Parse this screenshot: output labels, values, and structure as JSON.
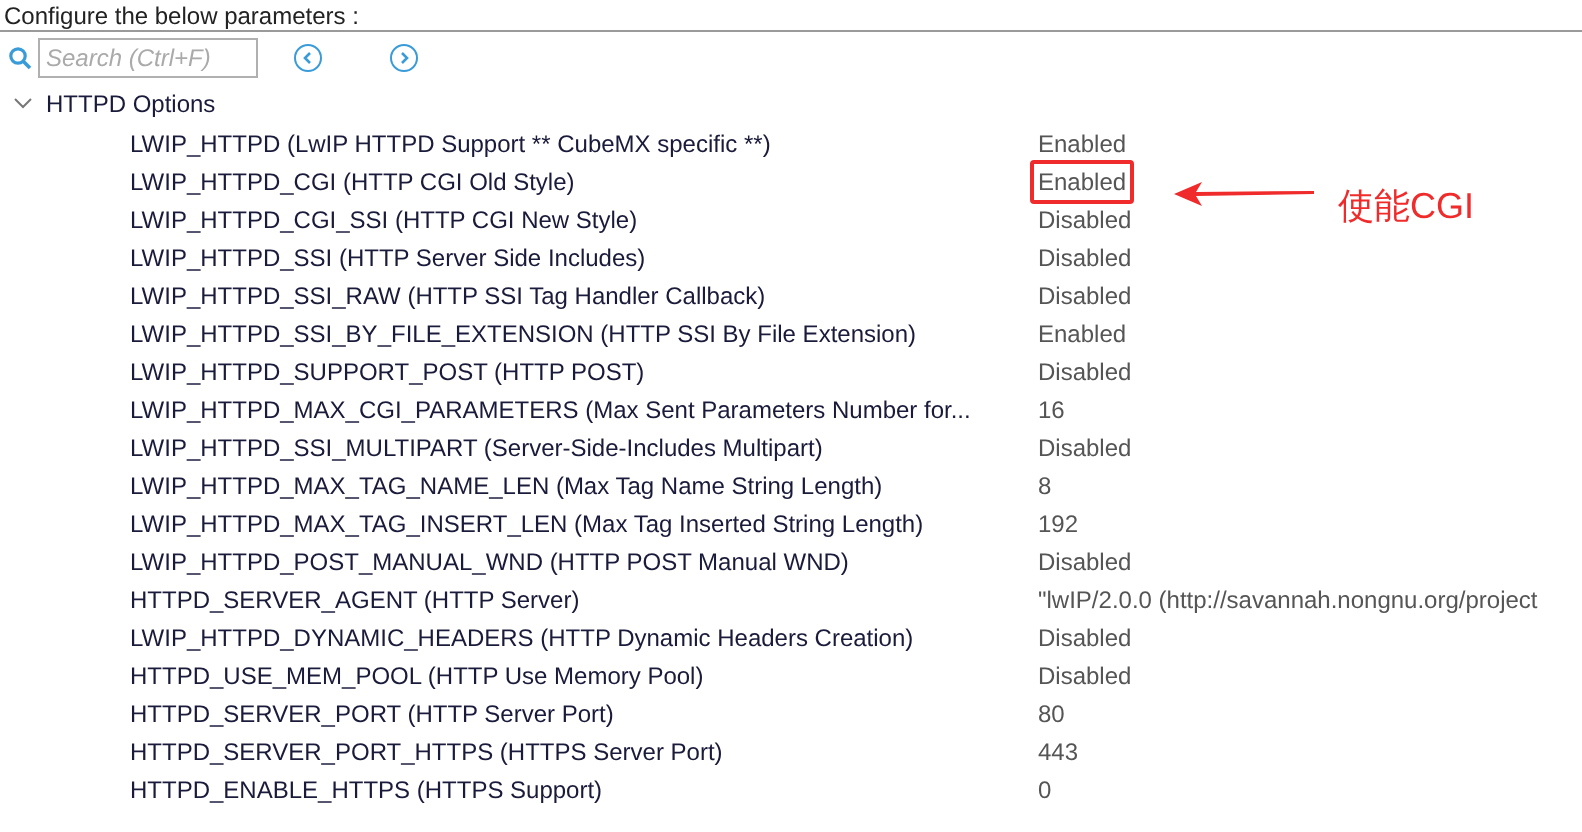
{
  "header": {
    "text": "Configure the below parameters :"
  },
  "search": {
    "placeholder": "Search (Ctrl+F)"
  },
  "tree": {
    "label": "HTTPD Options",
    "expanded": true,
    "children": [
      {
        "name": "LWIP_HTTPD (LwIP HTTPD Support ** CubeMX specific **)",
        "value": "Enabled",
        "highlighted": false
      },
      {
        "name": "LWIP_HTTPD_CGI (HTTP CGI Old Style)",
        "value": "Enabled",
        "highlighted": true
      },
      {
        "name": "LWIP_HTTPD_CGI_SSI (HTTP CGI New Style)",
        "value": "Disabled",
        "highlighted": false
      },
      {
        "name": "LWIP_HTTPD_SSI (HTTP Server Side Includes)",
        "value": "Disabled",
        "highlighted": false
      },
      {
        "name": "LWIP_HTTPD_SSI_RAW (HTTP SSI Tag Handler Callback)",
        "value": "Disabled",
        "highlighted": false
      },
      {
        "name": "LWIP_HTTPD_SSI_BY_FILE_EXTENSION (HTTP SSI By File Extension)",
        "value": "Enabled",
        "highlighted": false
      },
      {
        "name": "LWIP_HTTPD_SUPPORT_POST (HTTP POST)",
        "value": "Disabled",
        "highlighted": false
      },
      {
        "name": "LWIP_HTTPD_MAX_CGI_PARAMETERS (Max Sent Parameters Number for...",
        "value": "16",
        "highlighted": false
      },
      {
        "name": "LWIP_HTTPD_SSI_MULTIPART (Server-Side-Includes Multipart)",
        "value": "Disabled",
        "highlighted": false
      },
      {
        "name": "LWIP_HTTPD_MAX_TAG_NAME_LEN (Max Tag Name String Length)",
        "value": "8",
        "highlighted": false
      },
      {
        "name": "LWIP_HTTPD_MAX_TAG_INSERT_LEN (Max Tag Inserted String Length)",
        "value": "192",
        "highlighted": false
      },
      {
        "name": "LWIP_HTTPD_POST_MANUAL_WND (HTTP POST Manual WND)",
        "value": "Disabled",
        "highlighted": false
      },
      {
        "name": "HTTPD_SERVER_AGENT (HTTP Server)",
        "value": "\"lwIP/2.0.0 (http://savannah.nongnu.org/project",
        "highlighted": false
      },
      {
        "name": "LWIP_HTTPD_DYNAMIC_HEADERS (HTTP Dynamic Headers Creation)",
        "value": "Disabled",
        "highlighted": false
      },
      {
        "name": "HTTPD_USE_MEM_POOL (HTTP Use Memory Pool)",
        "value": "Disabled",
        "highlighted": false
      },
      {
        "name": "HTTPD_SERVER_PORT (HTTP Server Port)",
        "value": "80",
        "highlighted": false
      },
      {
        "name": "HTTPD_SERVER_PORT_HTTPS (HTTPS Server Port)",
        "value": "443",
        "highlighted": false
      },
      {
        "name": "HTTPD_ENABLE_HTTPS (HTTPS Support)",
        "value": "0",
        "highlighted": false
      }
    ]
  },
  "annotation": {
    "text": "使能CGI"
  }
}
